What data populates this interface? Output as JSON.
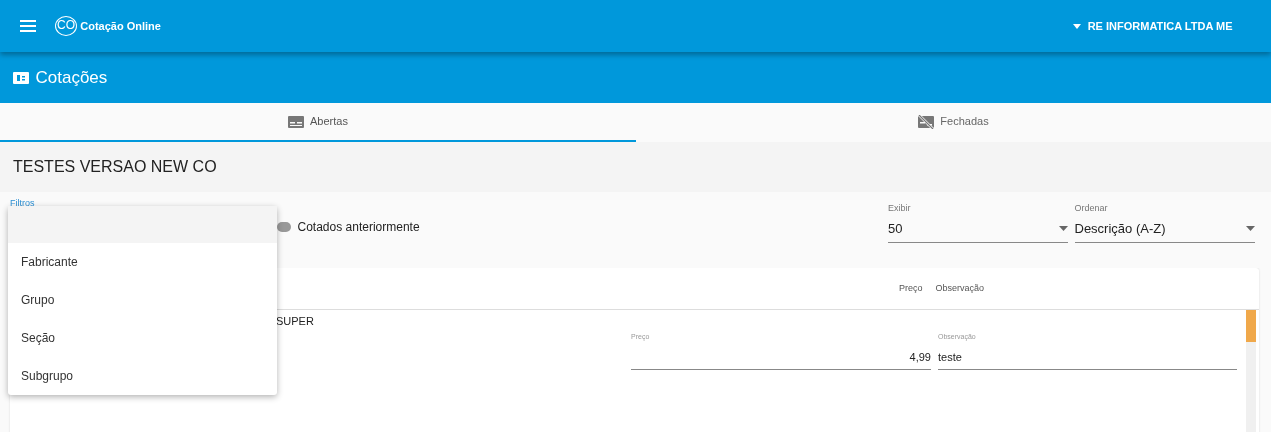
{
  "app": {
    "logo": "CO",
    "title": "Cotação Online",
    "user": "RE INFORMATICA LTDA ME"
  },
  "page": {
    "title": "Cotações"
  },
  "tabs": [
    {
      "label": "Abertas",
      "selected": true
    },
    {
      "label": "Fechadas",
      "selected": false
    }
  ],
  "quote": {
    "title": "TESTES VERSAO NEW CO"
  },
  "filters": {
    "label": "Filtros",
    "options": [
      "Fabricante",
      "Grupo",
      "Seção",
      "Subgrupo"
    ]
  },
  "toggle": {
    "label": "Cotados anteriormente",
    "on": false
  },
  "selects": [
    {
      "label": "Exibir",
      "value": "50"
    },
    {
      "label": "Ordenar",
      "value": "Descrição (A-Z)"
    }
  ],
  "table": {
    "columns": [
      "Preço",
      "Observação"
    ],
    "rows": [
      {
        "product": "SUPER",
        "price_label": "Preço",
        "price": "4,99",
        "note_label": "Observação",
        "note": "teste"
      }
    ]
  }
}
